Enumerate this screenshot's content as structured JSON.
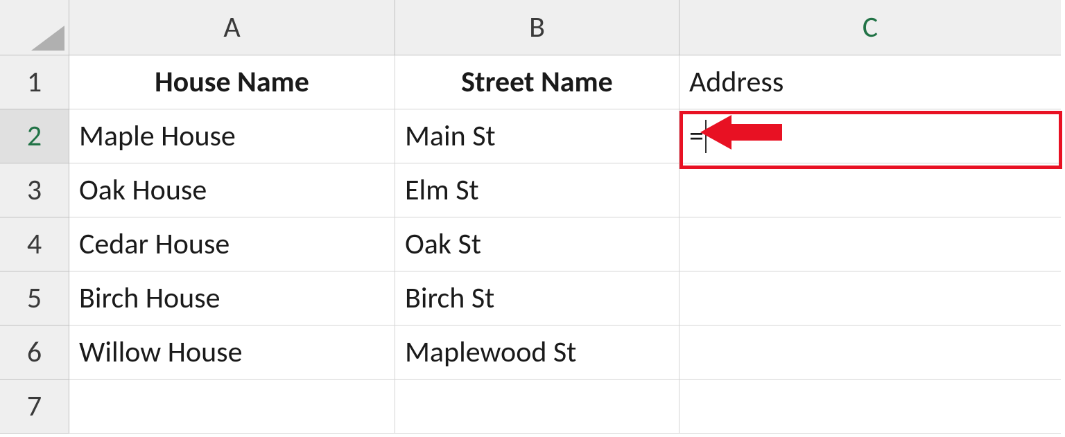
{
  "columns": [
    "A",
    "B",
    "C"
  ],
  "rows": [
    "1",
    "2",
    "3",
    "4",
    "5",
    "6",
    "7"
  ],
  "header_row": {
    "A": "House Name",
    "B": "Street Name",
    "C": "Address"
  },
  "data_rows": [
    {
      "A": "Maple House",
      "B": "Main St"
    },
    {
      "A": "Oak House",
      "B": "Elm St"
    },
    {
      "A": "Cedar House",
      "B": "Oak St"
    },
    {
      "A": "Birch House",
      "B": "Birch St"
    },
    {
      "A": "Willow House",
      "B": "Maplewood St"
    }
  ],
  "active_cell": {
    "ref": "C2",
    "value": "="
  },
  "highlight": {
    "color": "#e81123"
  }
}
